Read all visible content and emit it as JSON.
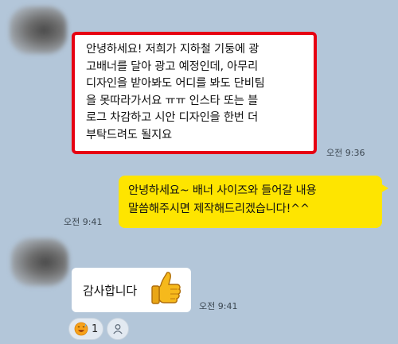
{
  "messages": [
    {
      "text": "안녕하세요! 저희가 지하철 기둥에 광\n고배너를 달아 광고 예정인데, 아무리\n디자인을 받아봐도 어디를 봐도 단비팀\n을 못따라가서요 ㅠㅠ 인스타 또는 블\n로그 차감하고 시안 디자인을 한번 더\n부탁드려도 될지요",
      "time": "오전 9:36"
    },
    {
      "text": "안녕하세요~ 배너 사이즈와 들어갈 내용\n말씀해주시면 제작해드리겠습니다!^^",
      "time": "오전 9:41"
    },
    {
      "text": "감사합니다",
      "time": "오전 9:41"
    }
  ],
  "reactions": {
    "emoji_icon": "grinning-sweat-emoji-icon",
    "count": "1",
    "add_icon": "person-add-icon"
  },
  "colors": {
    "background": "#b3c6d9",
    "my_bubble": "#fee500",
    "their_bubble": "#ffffff",
    "highlight_border": "#e60012"
  }
}
